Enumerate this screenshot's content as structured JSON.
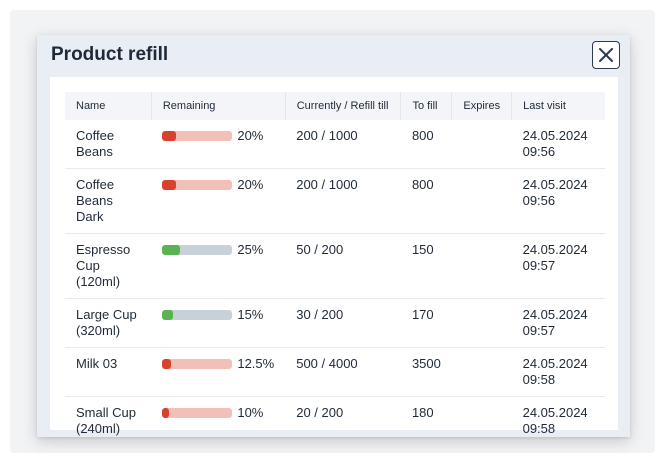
{
  "dialog": {
    "title": "Product refill",
    "close_icon": "close-icon"
  },
  "colors": {
    "low_fill": "#d9412f",
    "low_track": "#f2c0b8",
    "ok_fill": "#58b352",
    "ok_track": "#c8d0d8"
  },
  "table": {
    "headers": [
      "Name",
      "Remaining",
      "Currently / Refill till",
      "To fill",
      "Expires",
      "Last visit"
    ],
    "rows": [
      {
        "name": "Coffee Beans",
        "remaining": 0.2,
        "remaining_label": "20%",
        "status": "low",
        "current": "200 / 1000",
        "to_fill": "800",
        "expires": "",
        "last_visit": "24.05.2024 09:56"
      },
      {
        "name": "Coffee Beans Dark",
        "remaining": 0.2,
        "remaining_label": "20%",
        "status": "low",
        "current": "200 / 1000",
        "to_fill": "800",
        "expires": "",
        "last_visit": "24.05.2024 09:56"
      },
      {
        "name": "Espresso Cup (120ml)",
        "remaining": 0.25,
        "remaining_label": "25%",
        "status": "ok",
        "current": "50 / 200",
        "to_fill": "150",
        "expires": "",
        "last_visit": "24.05.2024 09:57"
      },
      {
        "name": "Large Cup (320ml)",
        "remaining": 0.15,
        "remaining_label": "15%",
        "status": "ok",
        "current": "30 / 200",
        "to_fill": "170",
        "expires": "",
        "last_visit": "24.05.2024 09:57"
      },
      {
        "name": "Milk 03",
        "remaining": 0.125,
        "remaining_label": "12.5%",
        "status": "low",
        "current": "500 / 4000",
        "to_fill": "3500",
        "expires": "",
        "last_visit": "24.05.2024 09:58"
      },
      {
        "name": "Small Cup (240ml)",
        "remaining": 0.1,
        "remaining_label": "10%",
        "status": "low",
        "current": "20 / 200",
        "to_fill": "180",
        "expires": "",
        "last_visit": "24.05.2024 09:58"
      }
    ]
  }
}
